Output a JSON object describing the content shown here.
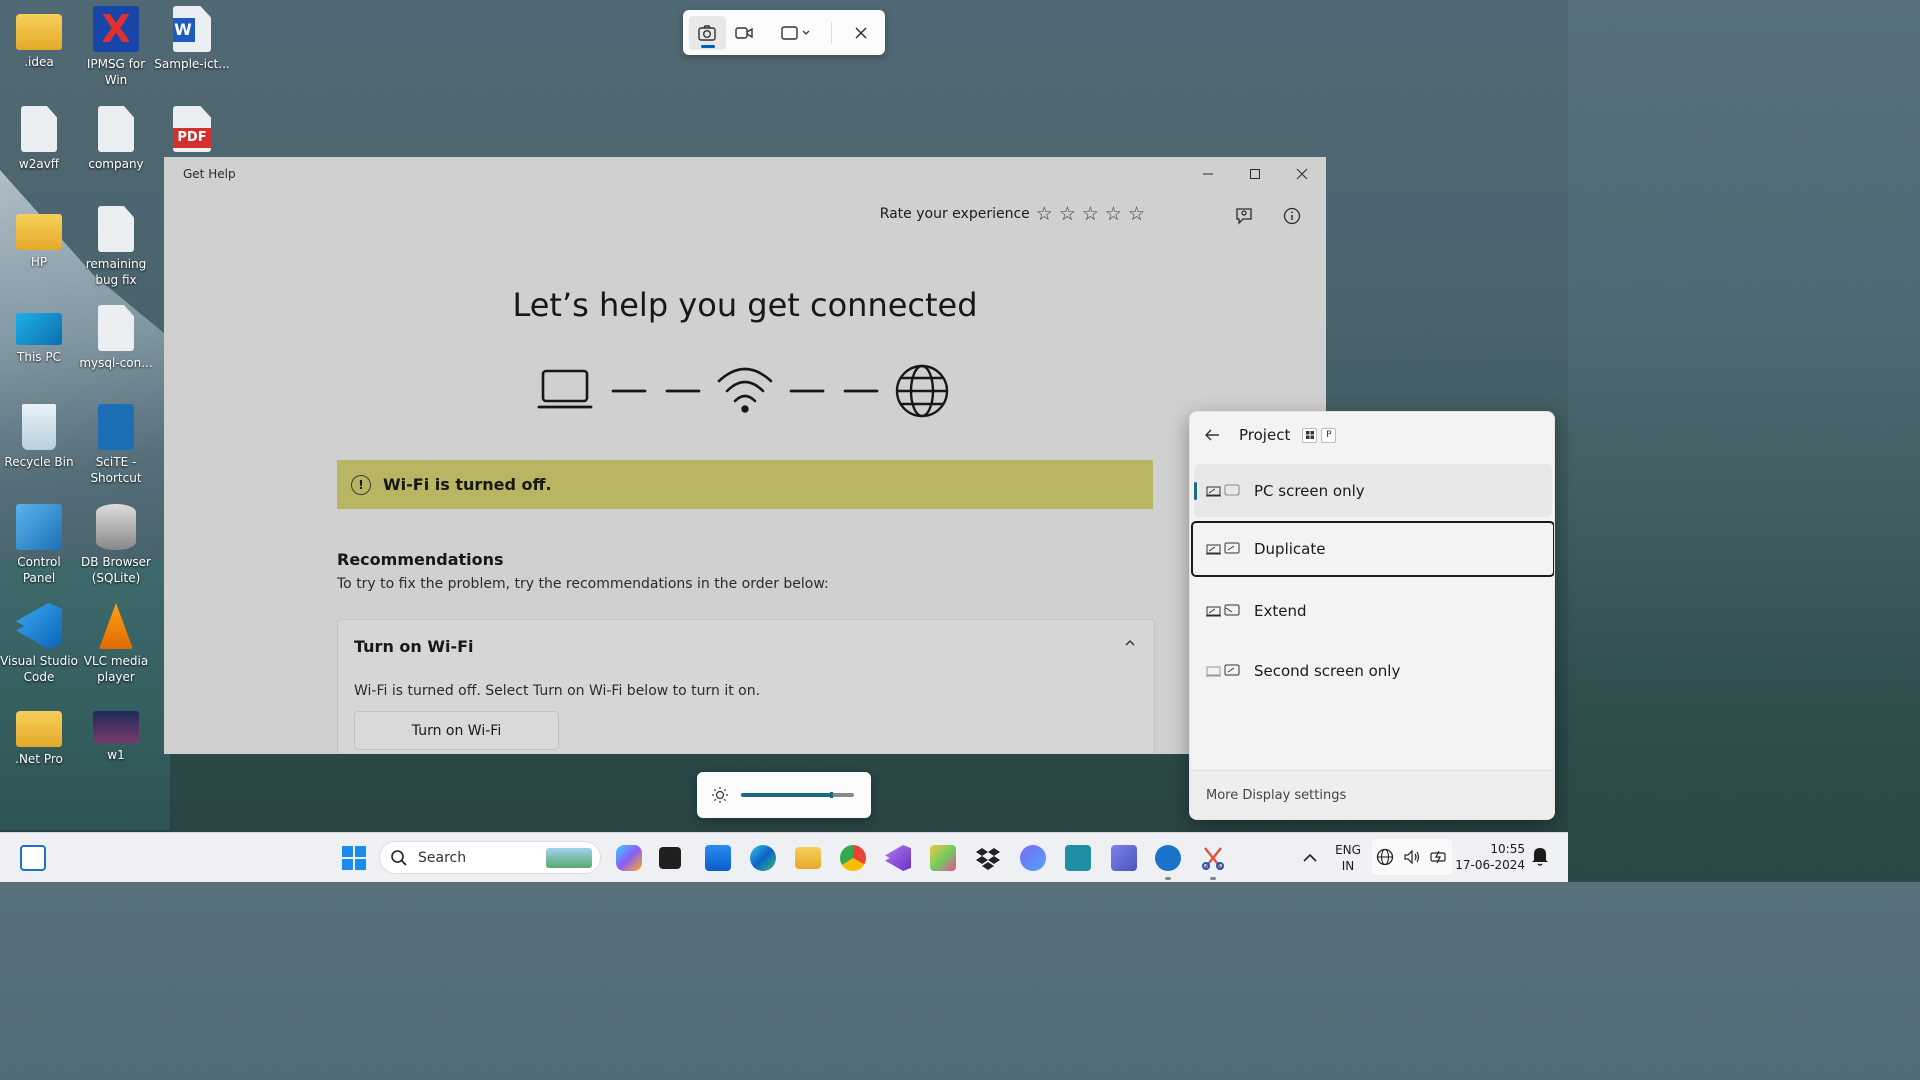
{
  "desktop": {
    "icons": [
      {
        "label": ".idea"
      },
      {
        "label": "IPMSG for Win"
      },
      {
        "label": "Sample-ict..."
      },
      {
        "label": "w2avff"
      },
      {
        "label": "company"
      },
      {
        "label": "HP"
      },
      {
        "label": "remaining bug fix"
      },
      {
        "label": "This PC"
      },
      {
        "label": "mysql-con..."
      },
      {
        "label": "Recycle Bin"
      },
      {
        "label": "SciTE - Shortcut"
      },
      {
        "label": "Control Panel"
      },
      {
        "label": "DB Browser (SQLite)"
      },
      {
        "label": "Visual Studio Code"
      },
      {
        "label": "VLC media player"
      },
      {
        "label": ".Net Pro"
      },
      {
        "label": "w1"
      }
    ]
  },
  "snip_toolbar": {
    "icons": [
      "camera-icon",
      "video-icon",
      "rectangle-mode-icon",
      "close-icon"
    ],
    "active_mode": "screenshot"
  },
  "get_help": {
    "window_title": "Get Help",
    "rate_label": "Rate your experience",
    "stars": 5,
    "heading": "Let’s help you get connected",
    "alert": "Wi-Fi is turned off.",
    "alert_color": "#d8d474",
    "recommendations_title": "Recommendations",
    "recommendations_desc": "To try to fix the problem, try the recommendations in the order below:",
    "expander_title": "Turn on Wi-Fi",
    "expander_text": "Wi-Fi is turned off. Select Turn on Wi-Fi below to turn it on.",
    "expander_button": "Turn on Wi-Fi"
  },
  "project_panel": {
    "title": "Project",
    "shortcut_key": "P",
    "options": [
      {
        "label": "PC screen only",
        "state": "selected"
      },
      {
        "label": "Duplicate",
        "state": "focused"
      },
      {
        "label": "Extend",
        "state": ""
      },
      {
        "label": "Second screen only",
        "state": ""
      }
    ],
    "footer": "More Display settings",
    "accent": "#1e6a80"
  },
  "brightness": {
    "level": 0.8
  },
  "taskbar": {
    "search_placeholder": "Search",
    "language": "ENG",
    "region": "IN",
    "time": "10:55",
    "date": "17-06-2024"
  }
}
